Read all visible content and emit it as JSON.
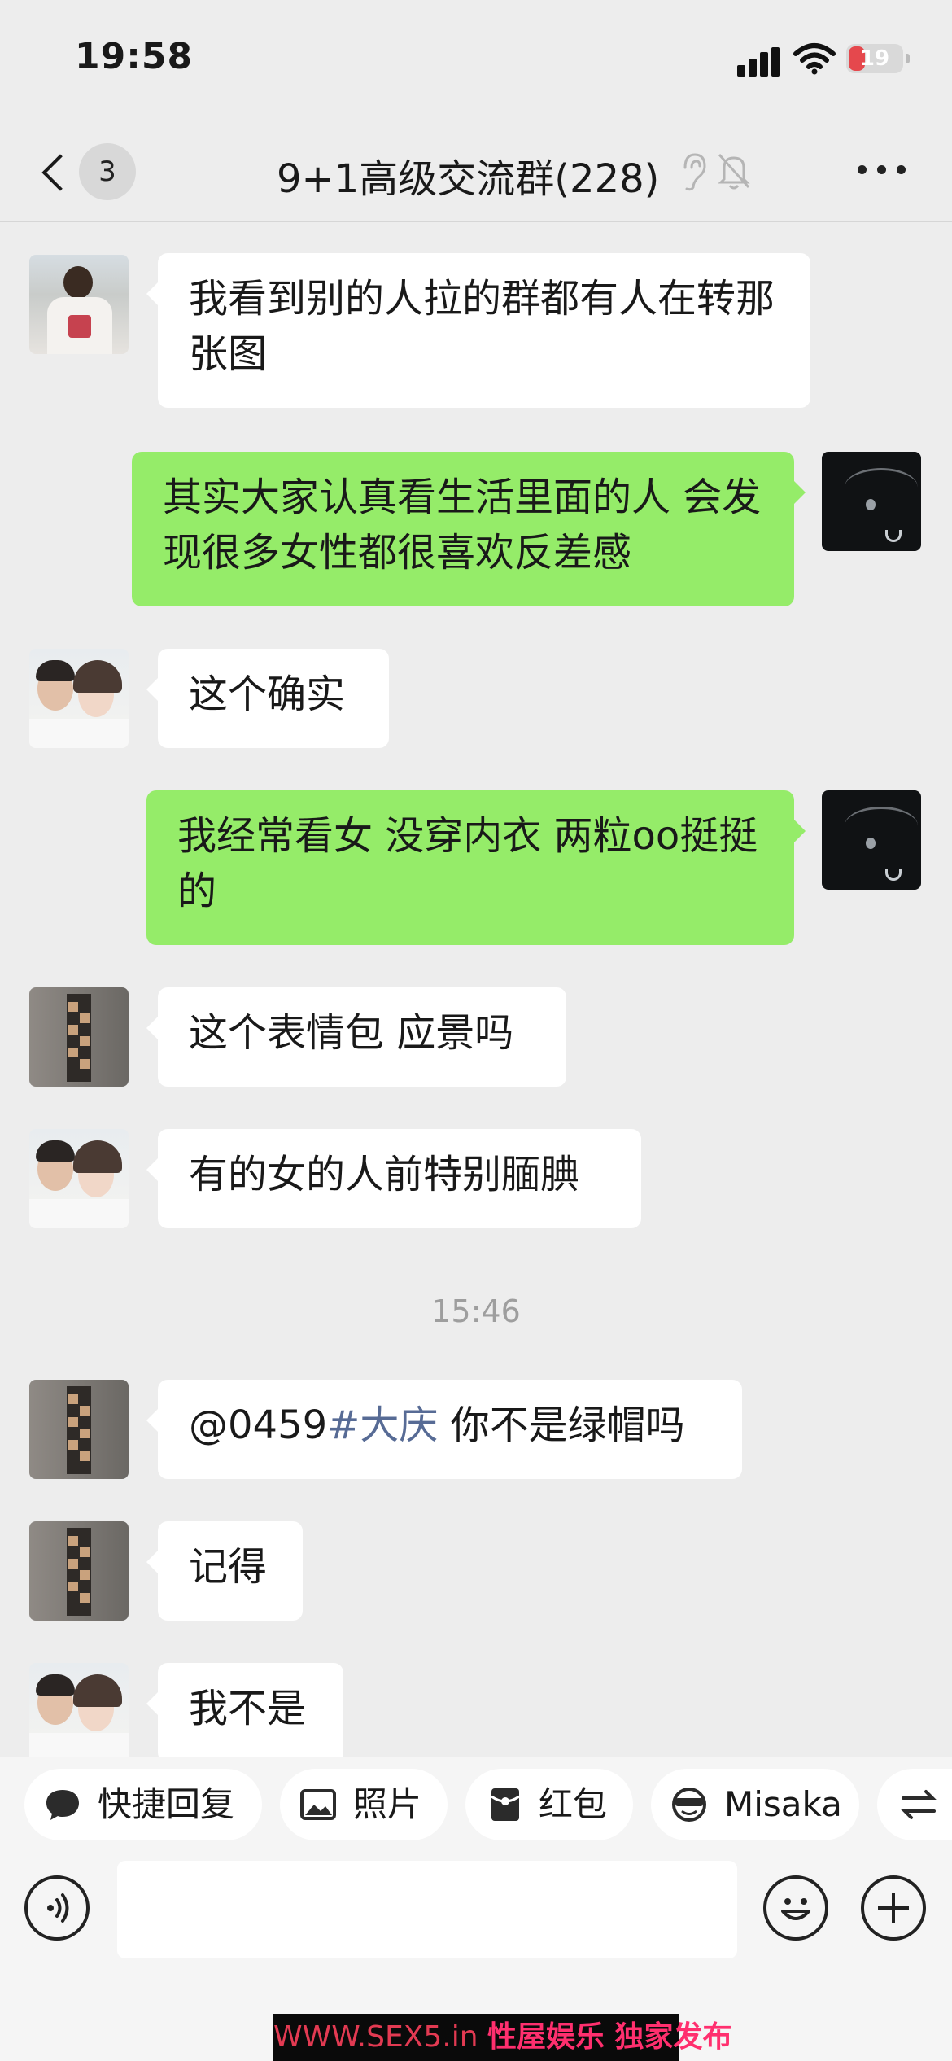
{
  "status_bar": {
    "time": "19:58",
    "battery": "19"
  },
  "header": {
    "back_count": "3",
    "title": "9+1高级交流群(228)"
  },
  "messages": [
    {
      "side": "in",
      "avatar": "portrait-man-tshirt",
      "text": "我看到别的人拉的群都有人在转那张图"
    },
    {
      "side": "out",
      "avatar": "dark-umbrella",
      "text": "其实大家认真看生活里面的人 会发现很多女性都很喜欢反差感"
    },
    {
      "side": "in",
      "avatar": "couple-photo",
      "text": "这个确实"
    },
    {
      "side": "out",
      "avatar": "dark-umbrella",
      "text": "我经常看女 没穿内衣 两粒oo挺挺的"
    },
    {
      "side": "in",
      "avatar": "wall-panel",
      "text": "这个表情包 应景吗"
    },
    {
      "side": "in",
      "avatar": "couple-photo",
      "text": "有的女的人前特别腼腆"
    },
    {
      "time": "15:46"
    },
    {
      "side": "in",
      "avatar": "wall-panel",
      "mention": "@0459",
      "hashtag": "#大庆",
      "text": " 你不是绿帽吗"
    },
    {
      "side": "in",
      "avatar": "wall-panel",
      "text": "记得"
    },
    {
      "side": "in",
      "avatar": "couple-photo",
      "text": "我不是"
    }
  ],
  "quick_actions": [
    {
      "label": "快捷回复",
      "icon": "chat-bubble-icon"
    },
    {
      "label": "照片",
      "icon": "photo-icon"
    },
    {
      "label": "红包",
      "icon": "red-packet-icon"
    },
    {
      "label": "Misaka",
      "icon": "sunglasses-emoji-icon"
    },
    {
      "label": "",
      "icon": "switch-arrows-icon"
    }
  ],
  "input": {
    "value": ""
  },
  "watermark": {
    "url": "WWW.SEX5.in",
    "text": "性屋娱乐 独家发布"
  }
}
